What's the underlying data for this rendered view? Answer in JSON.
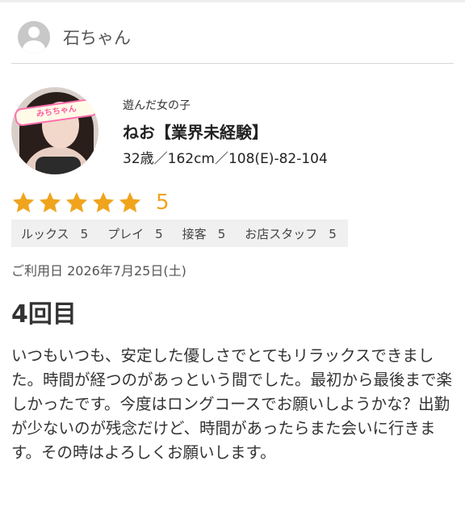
{
  "reviewer": {
    "name": "石ちゃん"
  },
  "profile": {
    "caption": "遊んだ女の子",
    "name": "ねお【業界未経験】",
    "stats": "32歳／162cm／108(E)-82-104",
    "photo_banner": "みちちゃん"
  },
  "rating": {
    "value": "5",
    "stars": 5,
    "star_color": "#f0a41d",
    "subratings": [
      {
        "label": "ルックス",
        "value": "5"
      },
      {
        "label": "プレイ",
        "value": "5"
      },
      {
        "label": "接客",
        "value": "5"
      },
      {
        "label": "お店スタッフ",
        "value": "5"
      }
    ]
  },
  "visit": {
    "date_text": "ご利用日 2026年7月25日(土)"
  },
  "review": {
    "title": "4回目",
    "body": "いつもいつも、安定した優しさでとてもリラックスできました。時間が経つのがあっという間でした。最初から最後まで楽しかったです。今度はロングコースでお願いしようかな？出勤が少ないのが残念だけど、時間があったらまた会いに行きます。その時はよろしくお願いします。"
  }
}
